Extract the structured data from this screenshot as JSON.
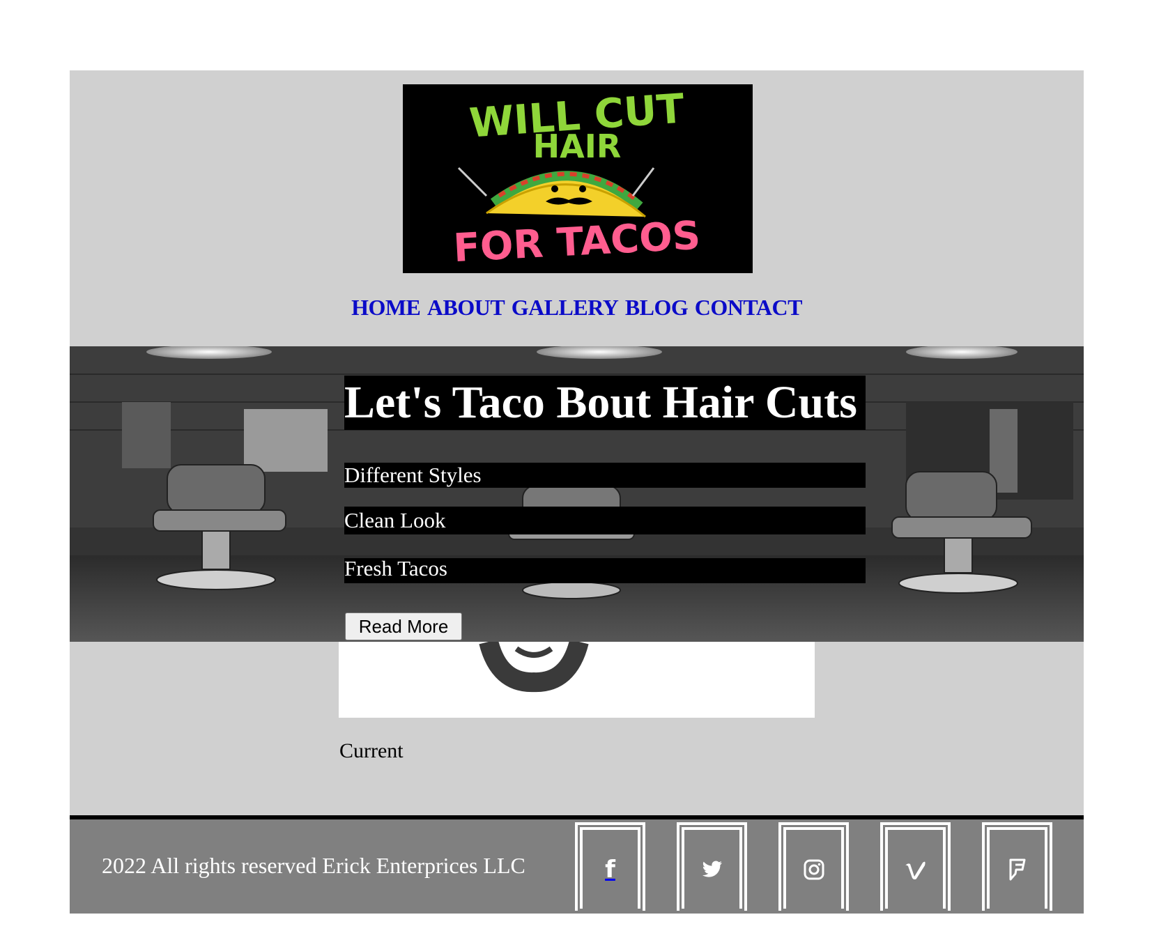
{
  "logo": {
    "line1": "WILL CUT",
    "line2": "HAIR",
    "line3": "FOR TACOS",
    "colors": {
      "green": "#8fd63a",
      "pink": "#ff5d8f",
      "taco": "#f3d02a"
    }
  },
  "nav": {
    "items": [
      "HOME",
      "ABOUT",
      "GALLERY",
      "BLOG",
      "CONTACT"
    ],
    "color": "#0b0bc8"
  },
  "hero": {
    "title": "Let's Taco Bout Hair Cuts",
    "lines": [
      "Different Styles",
      "Clean Look",
      "Fresh Tacos"
    ],
    "button": "Read More"
  },
  "content": {
    "status": "Current"
  },
  "footer": {
    "copyright": "2022 All rights reserved Erick Enterprices LLC",
    "social": [
      {
        "icon": "facebook-icon",
        "glyph": "f"
      },
      {
        "icon": "twitter-icon",
        "glyph": "🐦"
      },
      {
        "icon": "instagram-icon",
        "glyph": "◎"
      },
      {
        "icon": "vimeo-icon",
        "glyph": "v"
      },
      {
        "icon": "foursquare-icon",
        "glyph": "F"
      }
    ]
  }
}
